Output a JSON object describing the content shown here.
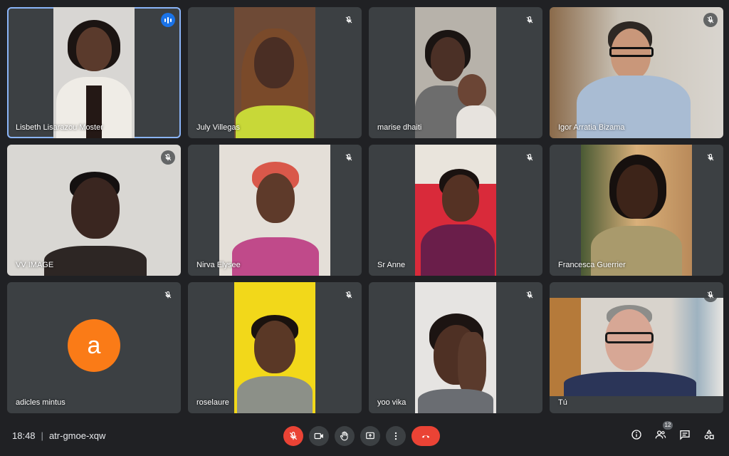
{
  "participants": [
    {
      "name": "Lisbeth Lisarazou Moster",
      "state": "speaking"
    },
    {
      "name": "July Villegas",
      "state": "muted"
    },
    {
      "name": "marise dhaiti",
      "state": "muted"
    },
    {
      "name": "Igor Arratia Bizama",
      "state": "muted"
    },
    {
      "name": "VV IMAGE",
      "state": "muted"
    },
    {
      "name": "Nirva Elysee",
      "state": "muted"
    },
    {
      "name": "Sr Anne",
      "state": "muted"
    },
    {
      "name": "Francesca Guerrier",
      "state": "muted"
    },
    {
      "name": "adicles mintus",
      "state": "muted",
      "avatar_letter": "a",
      "avatar_color": "#fa7b17"
    },
    {
      "name": "roselaure",
      "state": "muted"
    },
    {
      "name": "yoo vika",
      "state": "muted"
    },
    {
      "name": "Tú",
      "state": "muted"
    }
  ],
  "meeting": {
    "time": "18:48",
    "code": "atr-gmoe-xqw"
  },
  "controls": [
    "mic-off",
    "camera",
    "raise-hand",
    "present",
    "more",
    "leave-call"
  ],
  "people_count": "12",
  "colors": {
    "background": "#202124",
    "tile": "#3c4043",
    "accent": "#1a73e8",
    "danger": "#ea4335",
    "active_outline": "#8ab4f8"
  }
}
